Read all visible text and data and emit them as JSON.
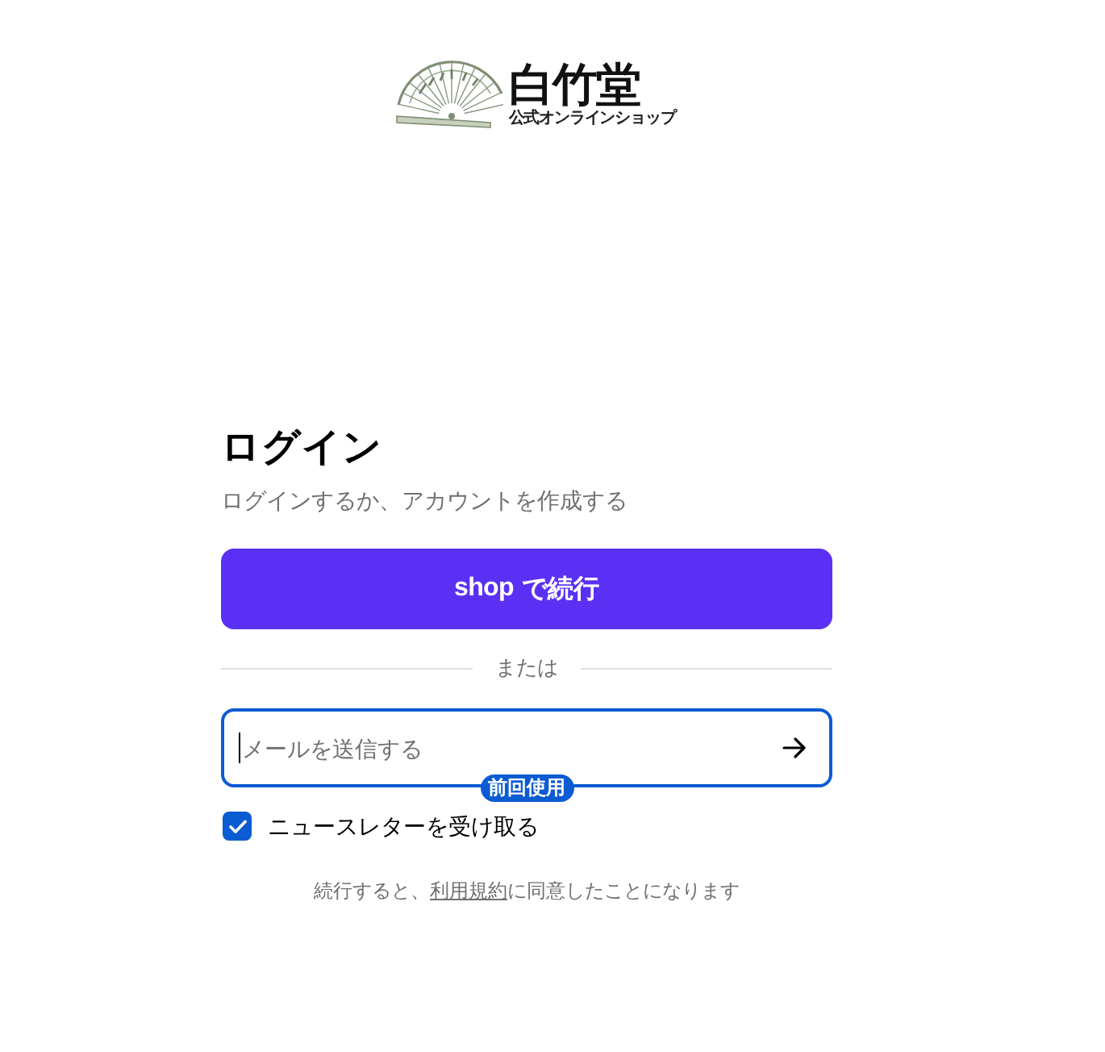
{
  "logo": {
    "name": "白竹堂",
    "tagline": "公式オンラインショップ"
  },
  "login": {
    "title": "ログイン",
    "subtitle": "ログインするか、アカウントを作成する"
  },
  "shop_button": {
    "brand": "shop",
    "label": "で続行"
  },
  "divider": {
    "label": "または"
  },
  "email_field": {
    "placeholder": "メールを送信する",
    "focused": true,
    "badge": "前回使用"
  },
  "newsletter": {
    "label": "ニュースレターを受け取る",
    "checked": true
  },
  "terms": {
    "before": "続行すると、",
    "link": "利用規約",
    "after": "に同意したことになります"
  }
}
